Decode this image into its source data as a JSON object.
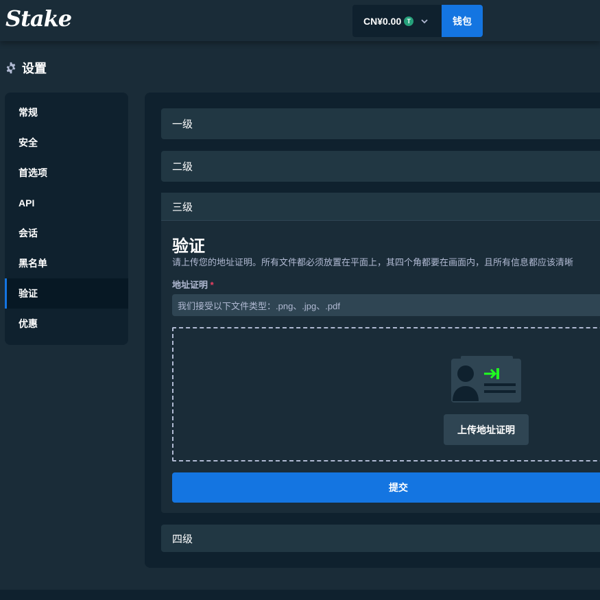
{
  "header": {
    "logo": "Stake",
    "balance": "CN¥0.00",
    "currency_icon": "T",
    "wallet_label": "钱包"
  },
  "page": {
    "title": "设置",
    "title_icon": "gear-icon"
  },
  "sidebar": {
    "items": [
      {
        "label": "常规"
      },
      {
        "label": "安全"
      },
      {
        "label": "首选项"
      },
      {
        "label": "API"
      },
      {
        "label": "会话"
      },
      {
        "label": "黑名单"
      },
      {
        "label": "验证",
        "active": true
      },
      {
        "label": "优惠"
      }
    ]
  },
  "levels": {
    "level1": "一级",
    "level2": "二级",
    "level3": "三级",
    "level4": "四级"
  },
  "verification": {
    "title": "验证",
    "description": "请上传您的地址证明。所有文件都必须放置在平面上，其四个角都要在画面内，且所有信息都应该清晰",
    "field_label": "地址证明",
    "required_mark": "*",
    "accepted_types": "我们接受以下文件类型：.png、.jpg、.pdf",
    "upload_button": "上传地址证明",
    "submit_button": "提交"
  },
  "colors": {
    "background": "#1a2c38",
    "panel": "#0f212e",
    "accent": "#1475e1",
    "currency_green": "#26a17b",
    "required_red": "#ed4163"
  }
}
